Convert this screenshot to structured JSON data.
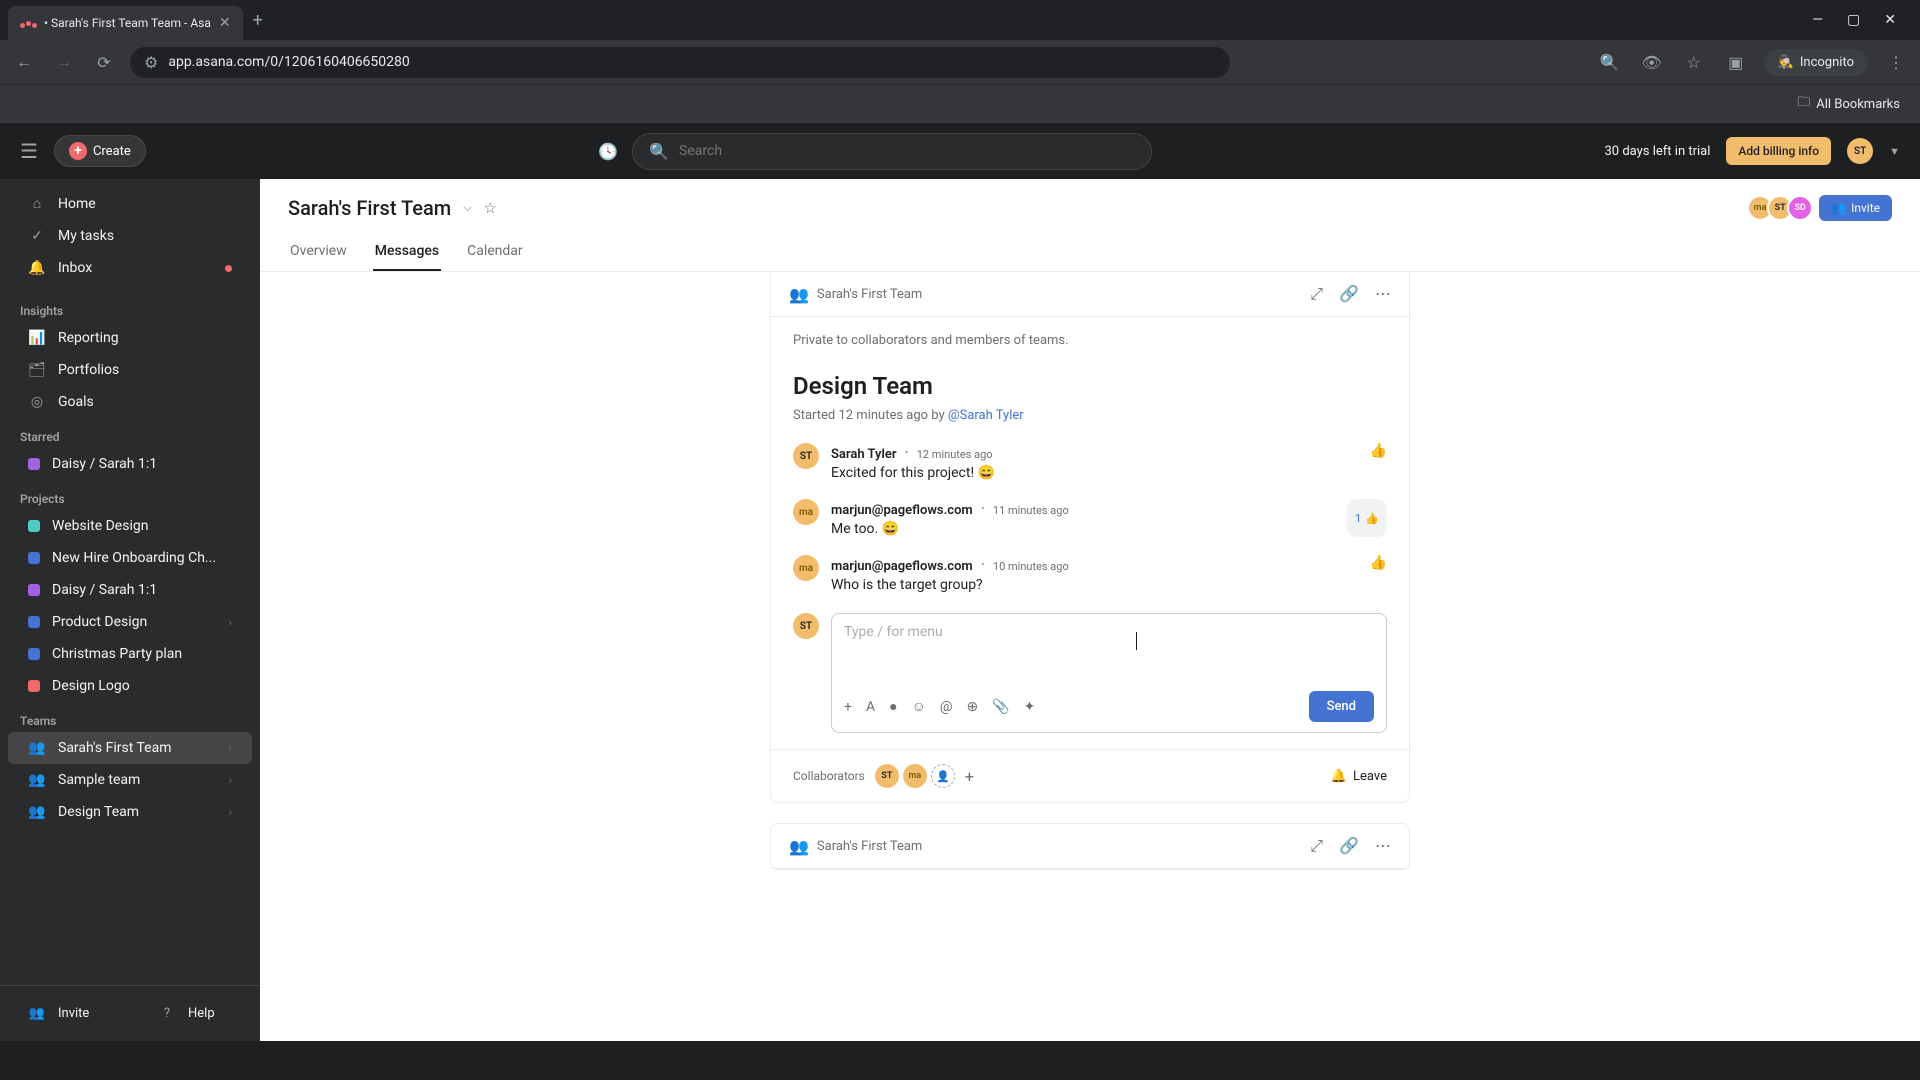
{
  "browser": {
    "tab_title": "• Sarah's First Team Team - Asa",
    "url": "app.asana.com/0/1206160406650280",
    "incognito_label": "Incognito",
    "all_bookmarks": "All Bookmarks"
  },
  "topbar": {
    "create_label": "Create",
    "search_placeholder": "Search",
    "trial_text": "30 days left in trial",
    "billing_label": "Add billing info",
    "user_initials": "ST"
  },
  "sidebar": {
    "home": "Home",
    "my_tasks": "My tasks",
    "inbox": "Inbox",
    "insights_heading": "Insights",
    "reporting": "Reporting",
    "portfolios": "Portfolios",
    "goals": "Goals",
    "starred_heading": "Starred",
    "starred_items": [
      {
        "label": "Daisy / Sarah 1:1",
        "color": "#a362e3"
      }
    ],
    "projects_heading": "Projects",
    "projects": [
      {
        "label": "Website Design",
        "color": "#4ecbc4"
      },
      {
        "label": "New Hire Onboarding Ch...",
        "color": "#4573d2"
      },
      {
        "label": "Daisy / Sarah 1:1",
        "color": "#a362e3"
      },
      {
        "label": "Product Design",
        "color": "#4573d2"
      },
      {
        "label": "Christmas Party plan",
        "color": "#4573d2"
      },
      {
        "label": "Design Logo",
        "color": "#f06a6a"
      }
    ],
    "teams_heading": "Teams",
    "teams": [
      {
        "label": "Sarah's First Team",
        "active": true
      },
      {
        "label": "Sample team",
        "active": false
      },
      {
        "label": "Design Team",
        "active": false
      }
    ],
    "invite": "Invite",
    "help": "Help"
  },
  "header": {
    "team_name": "Sarah's First Team",
    "tabs": [
      "Overview",
      "Messages",
      "Calendar"
    ],
    "active_tab": "Messages",
    "invite_btn": "Invite",
    "members": [
      "ma",
      "ST",
      "SD"
    ]
  },
  "conversation": {
    "card_team": "Sarah's First Team",
    "privacy": "Private to collaborators and members of teams.",
    "title": "Design Team",
    "started_prefix": "Started 12 minutes ago by ",
    "started_by": "@Sarah Tyler",
    "comments": [
      {
        "author": "Sarah Tyler",
        "time": "12 minutes ago",
        "text": "Excited for this project! 😄",
        "avatar": "ST",
        "avatar_class": "st",
        "likes": 0
      },
      {
        "author": "marjun@pageflows.com",
        "time": "11 minutes ago",
        "text": "Me too. 😄",
        "avatar": "ma",
        "avatar_class": "ma",
        "likes": 1
      },
      {
        "author": "marjun@pageflows.com",
        "time": "10 minutes ago",
        "text": "Who is the target group?",
        "avatar": "ma",
        "avatar_class": "ma",
        "likes": 0
      }
    ],
    "reply_placeholder": "Type / for menu",
    "send_label": "Send",
    "collaborators_label": "Collaborators",
    "leave_label": "Leave",
    "next_card_team": "Sarah's First Team"
  }
}
